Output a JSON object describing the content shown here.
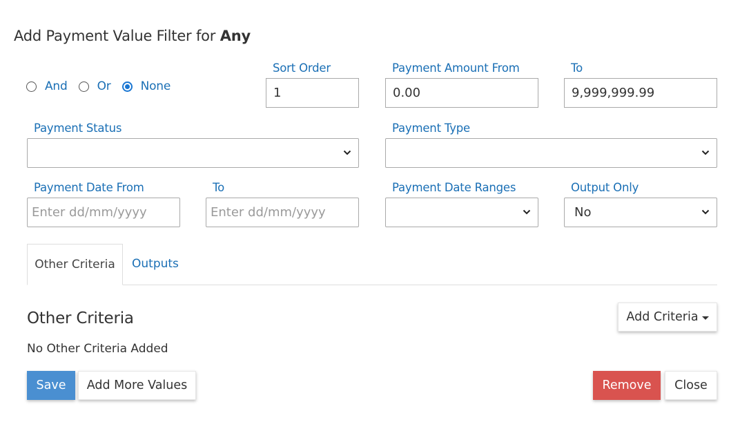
{
  "dialog": {
    "title_prefix": "Add Payment Value Filter for ",
    "title_target": "Any"
  },
  "logic": {
    "options": [
      {
        "label": "And",
        "checked": false
      },
      {
        "label": "Or",
        "checked": false
      },
      {
        "label": "None",
        "checked": true
      }
    ]
  },
  "fields": {
    "sort_order": {
      "label": "Sort Order",
      "value": "1"
    },
    "amount_from": {
      "label": "Payment Amount From",
      "value": "0.00"
    },
    "amount_to": {
      "label": "To",
      "value": "9,999,999.99"
    },
    "payment_status": {
      "label": "Payment Status",
      "value": ""
    },
    "payment_type": {
      "label": "Payment Type",
      "value": ""
    },
    "date_from": {
      "label": "Payment Date From",
      "placeholder": "Enter dd/mm/yyyy"
    },
    "date_to": {
      "label": "To",
      "placeholder": "Enter dd/mm/yyyy"
    },
    "date_ranges": {
      "label": "Payment Date Ranges",
      "value": ""
    },
    "output_only": {
      "label": "Output Only",
      "value": "No"
    }
  },
  "tabs": [
    {
      "label": "Other Criteria",
      "active": true
    },
    {
      "label": "Outputs",
      "active": false
    }
  ],
  "criteria": {
    "heading": "Other Criteria",
    "empty_text": "No Other Criteria Added",
    "add_button": "Add Criteria"
  },
  "actions": {
    "save": "Save",
    "add_more": "Add More Values",
    "remove": "Remove",
    "close": "Close"
  },
  "colors": {
    "accent": "#1a6fb5",
    "save": "#4a8fd1",
    "remove": "#d9534f"
  },
  "icons": {
    "select_arrow": "chevron-down-icon",
    "dropdown_caret": "caret-down-icon"
  }
}
